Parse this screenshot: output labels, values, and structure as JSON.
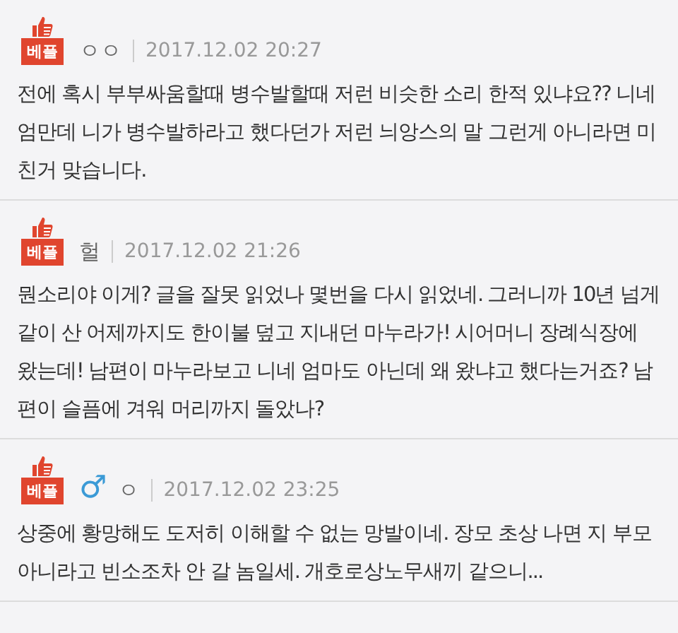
{
  "comments": [
    {
      "badge": "베플",
      "author": "ㅇㅇ",
      "date": "2017.12.02 20:27",
      "body": "전에 혹시 부부싸움할때 병수발할때 저런 비슷한 소리 한적 있냐요?? 니네엄만데 니가 병수발하라고 했다던가 저런 늬앙스의 말 그런게 아니라면 미친거 맞습니다."
    },
    {
      "badge": "베플",
      "author": "헐",
      "date": "2017.12.02 21:26",
      "body": "뭔소리야 이게? 글을 잘못 읽었나 몇번을 다시 읽었네. 그러니까 10년 넘게 같이 산 어제까지도 한이불 덮고 지내던 마누라가! 시어머니 장례식장에 왔는데! 남편이 마누라보고 니네 엄마도 아닌데 왜 왔냐고 했다는거죠? 남편이 슬픔에 겨워 머리까지 돌았나?"
    },
    {
      "badge": "베플",
      "symbol": "♂",
      "author": "ㅇ",
      "date": "2017.12.02 23:25",
      "body": "상중에 황망해도 도저히 이해할 수 없는 망발이네. 장모 초상 나면 지 부모 아니라고 빈소조차 안 갈 놈일세. 개호로상노무새끼 같으니..."
    }
  ]
}
